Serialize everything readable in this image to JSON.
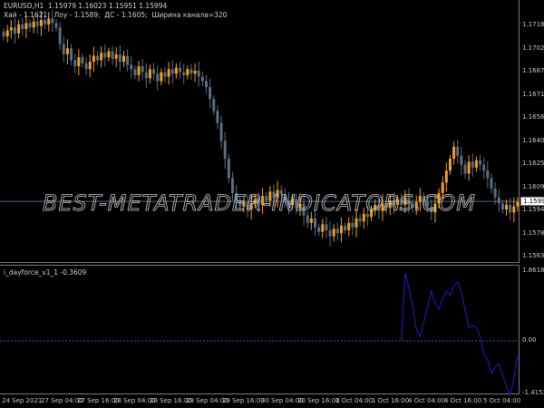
{
  "header": {
    "symbol_line": "EURUSD,H1  1.15979 1.16023 1.15951 1.15994",
    "info_line": "Хай - 1.1621;  Лоу - 1.1589;  ДС - 1.1605;  Ширина канала=320"
  },
  "watermark": "BEST-METATRADER-INDICATORS.COM",
  "price_axis": [
    "1.17180",
    "1.17025",
    "1.16870",
    "1.16715",
    "1.16560",
    "1.16405",
    "1.16250",
    "1.16095",
    "1.15940",
    "1.15785",
    "1.15630"
  ],
  "current_price": "1.15994",
  "indicator": {
    "label": "i_dayforce_v1_1 -0.3609",
    "max_label": "1.8618",
    "zero_label": "0.00",
    "min_label": "-1.4152",
    "line_color": "#1a1aa8",
    "values": [
      0,
      1.79,
      1.4,
      0.9,
      0.3,
      0.12,
      0.5,
      0.9,
      1.31,
      1.0,
      0.84,
      1.1,
      1.31,
      1.2,
      1.45,
      1.55,
      1.3,
      0.8,
      0.36,
      0.4,
      0.36,
      0.1,
      -0.36,
      -0.5,
      -0.84,
      -0.7,
      -0.6,
      -0.9,
      -1.19,
      -1.41,
      -1.0,
      -0.36
    ]
  },
  "time_axis": [
    "24 Sep 2021",
    "27 Sep 04:00",
    "27 Sep 16:00",
    "28 Sep 04:00",
    "28 Sep 16:00",
    "29 Sep 04:00",
    "29 Sep 16:00",
    "30 Sep 04:00",
    "30 Sep 16:00",
    "1 Oct 04:00",
    "1 Oct 16:00",
    "4 Oct 04:00",
    "4 Oct 16:00",
    "5 Oct 04:00"
  ],
  "colors": {
    "bull": "#f0a020",
    "bear": "#5a6e82",
    "current_line": "#4a6a8a"
  },
  "closes": [
    1.171,
    1.1714,
    1.1716,
    1.1712,
    1.1718,
    1.1715,
    1.1719,
    1.1716,
    1.172,
    1.1717,
    1.1721,
    1.1718,
    1.1722,
    1.1719,
    1.1716,
    1.1705,
    1.1698,
    1.1702,
    1.1694,
    1.169,
    1.1696,
    1.1692,
    1.1688,
    1.1693,
    1.1697,
    1.1694,
    1.1699,
    1.1696,
    1.17,
    1.1695,
    1.1698,
    1.1693,
    1.1697,
    1.1691,
    1.1688,
    1.1684,
    1.169,
    1.1686,
    1.1682,
    1.1688,
    1.1685,
    1.168,
    1.1686,
    1.1683,
    1.1688,
    1.1685,
    1.1689,
    1.1686,
    1.1684,
    1.1688,
    1.1685,
    1.1687,
    1.1683,
    1.168,
    1.1676,
    1.1668,
    1.166,
    1.1652,
    1.164,
    1.1628,
    1.1615,
    1.1605,
    1.16,
    1.1596,
    1.1599,
    1.1594,
    1.1598,
    1.1601,
    1.1597,
    1.1603,
    1.16,
    1.1606,
    1.1602,
    1.1607,
    1.1604,
    1.16,
    1.1597,
    1.1601,
    1.1595,
    1.1598,
    1.159,
    1.1585,
    1.1588,
    1.1582,
    1.1579,
    1.1584,
    1.158,
    1.1576,
    1.1581,
    1.1578,
    1.1583,
    1.158,
    1.1585,
    1.1582,
    1.1588,
    1.1586,
    1.1591,
    1.1589,
    1.1594,
    1.1597,
    1.1593,
    1.1598,
    1.1595,
    1.16,
    1.1597,
    1.1601,
    1.1597,
    1.1602,
    1.1598,
    1.1595,
    1.1599,
    1.1603,
    1.1599,
    1.1596,
    1.1592,
    1.1598,
    1.1605,
    1.1612,
    1.162,
    1.1628,
    1.1636,
    1.163,
    1.1624,
    1.1618,
    1.1626,
    1.1622,
    1.1627,
    1.1624,
    1.162,
    1.1615,
    1.1608,
    1.1602,
    1.1598,
    1.1594,
    1.1597,
    1.1592,
    1.1596,
    1.1599
  ]
}
